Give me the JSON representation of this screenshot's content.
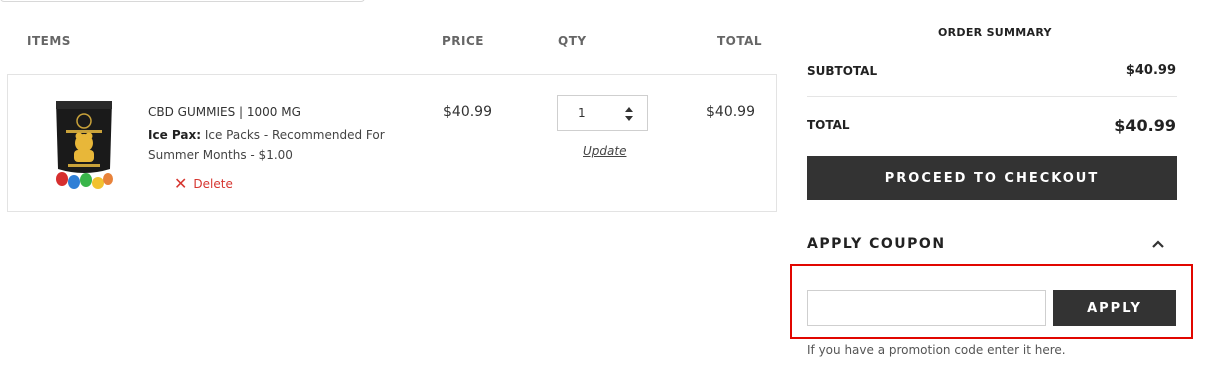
{
  "table_header": {
    "items": "ITEMS",
    "price": "PRICE",
    "qty": "QTY",
    "total": "TOTAL"
  },
  "cart_item": {
    "name": "CBD GUMMIES | 1000 MG",
    "option_label": "Ice Pax:",
    "option_value": "Ice Packs - Recommended For Summer Months - $1.00",
    "delete_label": "Delete",
    "price": "$40.99",
    "qty": "1",
    "update_label": "Update",
    "total": "$40.99",
    "image_icon": "product-image"
  },
  "summary": {
    "title": "ORDER SUMMARY",
    "subtotal_label": "SUBTOTAL",
    "subtotal_value": "$40.99",
    "total_label": "TOTAL",
    "total_value": "$40.99",
    "checkout_label": "PROCEED TO CHECKOUT"
  },
  "coupon": {
    "title": "APPLY COUPON",
    "input_value": "",
    "input_placeholder": "",
    "apply_label": "APPLY",
    "hint": "If you have a promotion code enter it here."
  },
  "colors": {
    "dark_button": "#333333",
    "delete_red": "#d6352f",
    "highlight_red": "#e10600"
  }
}
